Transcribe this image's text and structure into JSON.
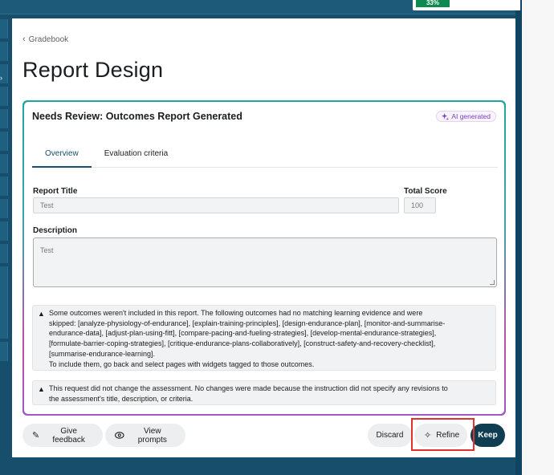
{
  "topbar": {
    "progress_label": "33%"
  },
  "breadcrumb": {
    "label": "Gradebook"
  },
  "page": {
    "title": "Report Design"
  },
  "panel": {
    "title": "Needs Review: Outcomes Report Generated",
    "ai_badge": "AI generated",
    "tabs": [
      {
        "label": "Overview",
        "active": true
      },
      {
        "label": "Evaluation criteria",
        "active": false
      }
    ]
  },
  "form": {
    "report_title_label": "Report Title",
    "report_title_value": "Test",
    "total_score_label": "Total Score",
    "total_score_value": "100",
    "description_label": "Description",
    "description_value": "Test"
  },
  "notices": [
    {
      "lines": [
        "Some outcomes weren't included in this report. The following outcomes had no matching learning evidence and were",
        "skipped: [analyze-physiology-of-endurance], [explain-training-principles], [design-endurance-plan], [monitor-and-summarise-",
        "endurance-data], [adjust-plan-using-fitt], [compare-pacing-and-fueling-strategies], [develop-mental-endurance-strategies],",
        "[formulate-barrier-coping-strategies], [critique-endurance-plans-collaboratively], [construct-safety-and-recovery-checklist],",
        "[summarise-endurance-learning].",
        "To include them, go back and select pages with widgets tagged to those outcomes."
      ]
    },
    {
      "lines": [
        "This request did not change the assessment. No changes were made because the instruction did not specify any revisions to",
        "the assessment's title, description, or criteria."
      ]
    }
  ],
  "footer": {
    "give_feedback": "Give feedback",
    "view_prompts": "View prompts",
    "discard": "Discard",
    "refine": "Refine",
    "keep": "Keep"
  },
  "colors": {
    "app_background": "#164e6c",
    "keep_button": "#0f3e52",
    "ai_badge": "#7a42b8",
    "highlight": "#e2322f"
  }
}
